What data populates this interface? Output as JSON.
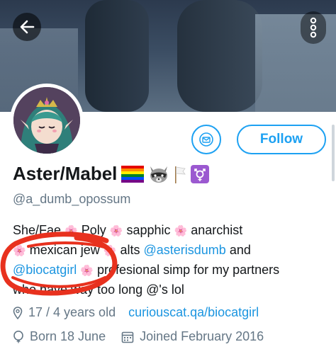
{
  "header": {
    "back_icon": "arrow-left-icon",
    "menu_icon": "kebab-vertical-icon"
  },
  "actions": {
    "mail_icon": "envelope-icon",
    "follow_label": "Follow"
  },
  "profile": {
    "display_name": "Aster/Mabel",
    "name_emojis": [
      "rainbow-flag",
      "raccoon",
      "white-flag",
      "transgender-symbol"
    ],
    "handle": "@a_dumb_opossum"
  },
  "bio": {
    "line1_a": "She/Fae",
    "line1_b": "Poly",
    "line1_c": "sapphic",
    "line1_d": "anarchist",
    "line2_a": "mexican jew",
    "line2_b": "alts",
    "line2_link": "@asterisdumb",
    "line2_c": "and",
    "line3_link": "@biocatgirl",
    "line3_b": "profesional simp for my partners",
    "line4": "who have way too long @'s lol"
  },
  "meta": {
    "location": "17 / 4 years old",
    "url": "curiouscat.qa/biocatgirl",
    "birthday": "Born 18 June",
    "joined": "Joined February 2016"
  },
  "colors": {
    "accent": "#1da1f2",
    "link": "#1b95e0",
    "muted": "#657786",
    "annotation": "#e8311e"
  }
}
